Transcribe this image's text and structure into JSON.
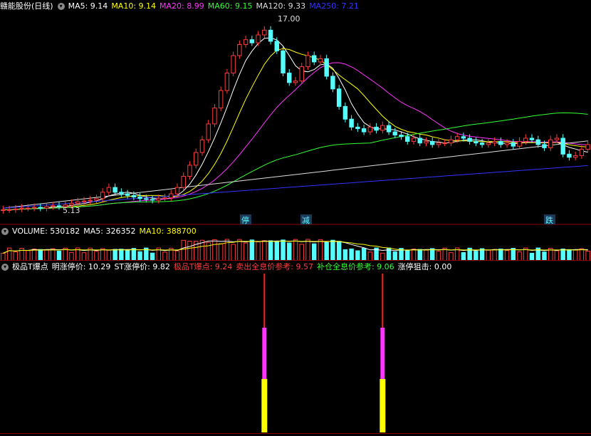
{
  "main": {
    "stock": "赣能股份(日线)",
    "ma": [
      {
        "label": "MA5: 9.14",
        "color": "#ffffff"
      },
      {
        "label": "MA10: 9.14",
        "color": "#ffff00"
      },
      {
        "label": "MA20: 8.99",
        "color": "#ff33ff"
      },
      {
        "label": "MA60: 9.15",
        "color": "#33ff33"
      },
      {
        "label": "MA120: 9.33",
        "color": "#dddddd"
      },
      {
        "label": "MA250: 7.21",
        "color": "#3333ff"
      }
    ],
    "high_label": "17.00",
    "low_label": "5.13",
    "markers": [
      "停",
      "减",
      "跌"
    ]
  },
  "volume": {
    "label": "VOLUME: 530182",
    "ma5": "MA5: 326352",
    "ma10": "MA10: 388700"
  },
  "indicator": {
    "name": "极品T爆点",
    "items": [
      {
        "label": "明涨停价: 10.29",
        "color": "#ffffff"
      },
      {
        "label": "ST涨停价: 9.82",
        "color": "#ffffff"
      },
      {
        "label": "极品T爆点: 9.24",
        "color": "#ff3b3b"
      },
      {
        "label": "卖出全息价参考: 9.57",
        "color": "#ff3b3b"
      },
      {
        "label": "补仓全息价参考: 9.06",
        "color": "#33ff33"
      },
      {
        "label": "涨停狙击: 0.00",
        "color": "#ffffff"
      }
    ]
  },
  "chart_data": {
    "type": "candlestick",
    "high": 17.0,
    "low": 5.13,
    "ylim": [
      4.5,
      17.5
    ],
    "closes": [
      5.2,
      5.2,
      5.25,
      5.3,
      5.3,
      5.35,
      5.3,
      5.4,
      5.45,
      5.4,
      5.5,
      5.6,
      5.7,
      5.75,
      5.8,
      5.9,
      6.3,
      6.6,
      6.3,
      6.2,
      6.1,
      6.0,
      5.9,
      5.85,
      5.8,
      5.9,
      5.95,
      6.2,
      6.6,
      7.3,
      8.0,
      8.8,
      9.6,
      10.6,
      11.6,
      12.7,
      13.8,
      14.9,
      15.6,
      15.9,
      15.7,
      16.2,
      16.5,
      15.8,
      15.2,
      13.8,
      13.2,
      13.3,
      14.2,
      14.9,
      14.5,
      14.7,
      13.6,
      12.8,
      11.7,
      10.9,
      10.4,
      10.3,
      10.1,
      10.4,
      10.2,
      10.5,
      10.1,
      9.9,
      9.8,
      9.5,
      9.7,
      9.4,
      9.5,
      9.3,
      9.4,
      9.4,
      9.6,
      9.8,
      9.7,
      9.5,
      9.4,
      9.3,
      9.4,
      9.5,
      9.3,
      9.4,
      9.2,
      9.5,
      9.7,
      9.6,
      9.3,
      9.1,
      9.6,
      9.7,
      8.7,
      8.5,
      8.6,
      9.0,
      9.3
    ],
    "volume_series": "VOLUME",
    "volume_ma": [
      "MA5",
      "MA10"
    ],
    "bar_events": [
      42,
      61
    ]
  }
}
